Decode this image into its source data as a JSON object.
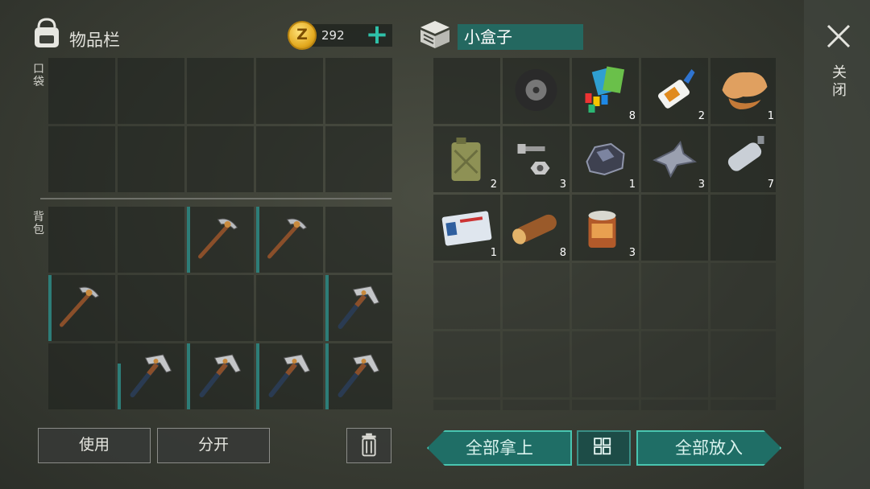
{
  "inventory": {
    "title": "物品栏",
    "coins": "292",
    "pocket_label": "口袋",
    "backpack_label": "背包",
    "pocket_slots": [
      "",
      "",
      "",
      "",
      "",
      "",
      "",
      "",
      "",
      ""
    ],
    "backpack_slots": [
      {
        "item": "",
        "count": ""
      },
      {
        "item": "",
        "count": ""
      },
      {
        "item": "pickaxe-icon",
        "count": ""
      },
      {
        "item": "pickaxe-icon",
        "count": ""
      },
      {
        "item": "",
        "count": ""
      },
      {
        "item": "pickaxe-icon",
        "count": ""
      },
      {
        "item": "",
        "count": ""
      },
      {
        "item": "",
        "count": ""
      },
      {
        "item": "",
        "count": ""
      },
      {
        "item": "hammer-icon",
        "count": ""
      },
      {
        "item": "",
        "count": ""
      },
      {
        "item": "hammer-icon",
        "count": ""
      },
      {
        "item": "hammer-icon",
        "count": ""
      },
      {
        "item": "hammer-icon",
        "count": ""
      },
      {
        "item": "hammer-icon",
        "count": ""
      }
    ],
    "use_label": "使用",
    "split_label": "分开"
  },
  "container": {
    "title": "小盒子",
    "slots": [
      {
        "item": "",
        "count": ""
      },
      {
        "item": "tire-icon",
        "count": ""
      },
      {
        "item": "electronics-icon",
        "count": "8"
      },
      {
        "item": "glue-icon",
        "count": "2"
      },
      {
        "item": "leather-icon",
        "count": "1"
      },
      {
        "item": "jerrycan-icon",
        "count": "2"
      },
      {
        "item": "bolts-icon",
        "count": "3"
      },
      {
        "item": "ore-icon",
        "count": "1"
      },
      {
        "item": "scrap-metal-icon",
        "count": "3"
      },
      {
        "item": "bottle-icon",
        "count": "7"
      },
      {
        "item": "id-card-icon",
        "count": "1"
      },
      {
        "item": "log-icon",
        "count": "8"
      },
      {
        "item": "tin-can-icon",
        "count": "3"
      },
      {
        "item": "",
        "count": ""
      },
      {
        "item": "",
        "count": ""
      }
    ],
    "take_all_label": "全部拿上",
    "put_all_label": "全部放入"
  },
  "panel": {
    "close_label": "关闭"
  },
  "colors": {
    "accent": "#2fc1a9",
    "button_teal": "#1f6e66",
    "title_bg": "#246860"
  }
}
